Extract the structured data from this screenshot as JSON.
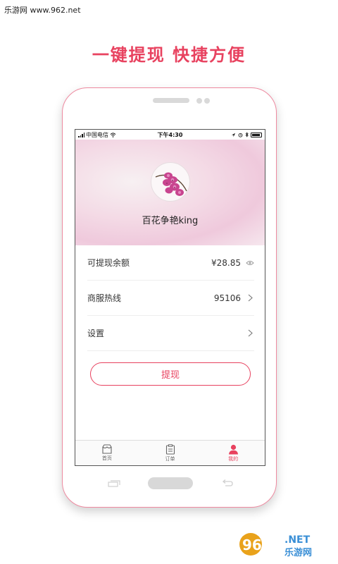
{
  "watermark": "乐游网 www.962.net",
  "headline": "一键提现  快捷方便",
  "status_bar": {
    "carrier": "中国电信",
    "time": "下午4:30",
    "icons": [
      "signal-icon",
      "wifi-icon",
      "location-icon",
      "alarm-icon",
      "bluetooth-icon",
      "battery-icon"
    ]
  },
  "profile": {
    "username": "百花争艳king",
    "avatar": "orchid-flower-avatar"
  },
  "rows": [
    {
      "label": "可提现余额",
      "value": "¥28.85",
      "trail_icon": "eye-icon"
    },
    {
      "label": "商服热线",
      "value": "95106",
      "trail_icon": "chevron-right-icon"
    },
    {
      "label": "设置",
      "value": "",
      "trail_icon": "chevron-right-icon"
    }
  ],
  "withdraw_button": "提现",
  "tabs": [
    {
      "label": "首页",
      "icon": "shop-icon",
      "active": false
    },
    {
      "label": "订单",
      "icon": "order-icon",
      "active": false
    },
    {
      "label": "我的",
      "icon": "user-icon",
      "active": true
    }
  ],
  "logo": {
    "text_number": "962",
    "text_net": ".NET",
    "text_cn": "乐游网"
  },
  "colors": {
    "accent": "#e8425f",
    "frame": "#ee8aa0"
  }
}
